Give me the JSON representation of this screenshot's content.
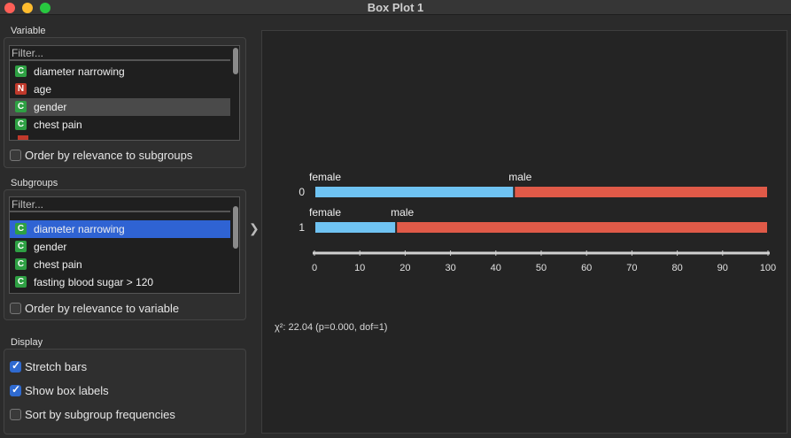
{
  "window": {
    "title": "Box Plot 1"
  },
  "variable": {
    "label": "Variable",
    "filter_placeholder": "Filter...",
    "items": [
      {
        "type": "C",
        "name": "diameter narrowing"
      },
      {
        "type": "N",
        "name": "age"
      },
      {
        "type": "C",
        "name": "gender",
        "selected": true
      },
      {
        "type": "C",
        "name": "chest pain"
      }
    ],
    "order_label": "Order by relevance to subgroups"
  },
  "subgroups": {
    "label": "Subgroups",
    "filter_placeholder": "Filter...",
    "items": [
      {
        "type": "C",
        "name": "diameter narrowing",
        "selected": true
      },
      {
        "type": "C",
        "name": "gender"
      },
      {
        "type": "C",
        "name": "chest pain"
      },
      {
        "type": "C",
        "name": "fasting blood sugar > 120"
      }
    ],
    "order_label": "Order by relevance to variable"
  },
  "display": {
    "label": "Display",
    "stretch_bars": "Stretch bars",
    "show_box_labels": "Show box labels",
    "sort_by_freq": "Sort by subgroup frequencies"
  },
  "chart_data": {
    "type": "bar",
    "orientation": "horizontal",
    "stacked": true,
    "stretched_percent": true,
    "categories": [
      "0",
      "1"
    ],
    "series": [
      {
        "name": "female",
        "color": "#6fc3f2",
        "values": [
          44,
          18
        ]
      },
      {
        "name": "male",
        "color": "#e05a48",
        "values": [
          56,
          82
        ]
      }
    ],
    "xlim": [
      0,
      100
    ],
    "xticks": [
      0,
      10,
      20,
      30,
      40,
      50,
      60,
      70,
      80,
      90,
      100
    ],
    "stat": "χ²: 22.04 (p=0.000, dof=1)"
  }
}
